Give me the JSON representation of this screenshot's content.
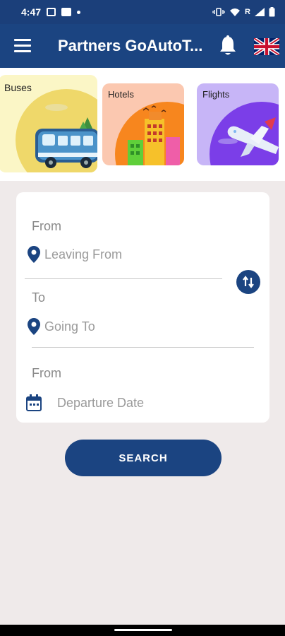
{
  "status_bar": {
    "time": "4:47",
    "carrier_indicator": "R"
  },
  "app_bar": {
    "title": "Partners GoAutoT...",
    "icons": [
      "menu-icon",
      "bell-icon",
      "uk-flag-icon"
    ]
  },
  "categories": [
    {
      "label": "Buses"
    },
    {
      "label": "Hotels"
    },
    {
      "label": "Flights"
    }
  ],
  "search_form": {
    "from_label": "From",
    "from_placeholder": "Leaving From",
    "to_label": "To",
    "to_placeholder": "Going To",
    "date_label": "From",
    "date_placeholder": "Departure Date"
  },
  "search_button_label": "SEARCH",
  "colors": {
    "primary": "#1b4481",
    "background": "#efeaea",
    "card": "#ffffff"
  }
}
